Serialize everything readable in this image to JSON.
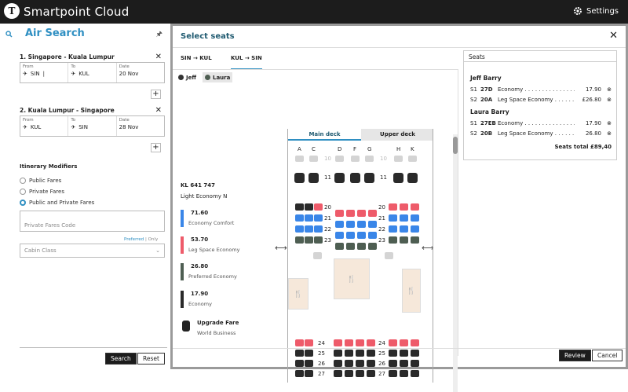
{
  "app": {
    "name": "Smartpoint Cloud",
    "settings": "Settings"
  },
  "left": {
    "title": "Air Search",
    "segments": [
      {
        "title": "1. Singapore - Kuala Lumpur",
        "from_label": "From",
        "from": "SIN",
        "to_label": "To",
        "to": "KUL",
        "date_label": "Date",
        "date": "20 Nov"
      },
      {
        "title": "2. Kuala Lumpur - Singapore",
        "from_label": "From",
        "from": "KUL",
        "to_label": "To",
        "to": "SIN",
        "date_label": "Date",
        "date": "28 Nov"
      }
    ],
    "modifiers_title": "Itinerary Modifiers",
    "fares": [
      "Public Fares",
      "Private Fares",
      "Public and Private Fares"
    ],
    "private_code_placeholder": "Private Fares Code",
    "preferred": "Preferred",
    "only": "Only",
    "pipe": "|",
    "cabin_class": "Cabin Class",
    "search": "Search",
    "reset": "Reset"
  },
  "modal": {
    "title": "Select seats",
    "direction_tabs": [
      "SIN → KUL",
      "KUL → SIN"
    ],
    "passenger_tabs": [
      "Jeff",
      "Laura"
    ],
    "flight": "KL 641   747",
    "cabin": "Light Economy   N",
    "deck_tabs": [
      "Main deck",
      "Upper deck"
    ],
    "columns": [
      "A",
      "C",
      "D",
      "F",
      "G",
      "H",
      "K"
    ],
    "rows_upper": [
      "11"
    ],
    "rows_mid": [
      "20",
      "21",
      "22",
      "23"
    ],
    "rows_low": [
      "24",
      "25",
      "26",
      "27"
    ],
    "row_muted": "10",
    "legend": [
      {
        "price": "71.60",
        "name": "Economy Comfort",
        "color": "#3a86e8"
      },
      {
        "price": "53.70",
        "name": "Leg Space Economy",
        "color": "#ee5b6a"
      },
      {
        "price": "26.80",
        "name": "Preferred Economy",
        "color": "#4e5e52"
      },
      {
        "price": "17.90",
        "name": "Economy",
        "color": "#2a2a2a"
      },
      {
        "price": "Upgrade Fare",
        "name": "World Business",
        "color": "#2a2a2a"
      }
    ],
    "seats_header": "Seats",
    "passengers": [
      {
        "name": "Jeff Barry",
        "seats": [
          {
            "seg": "S1",
            "seat": "27D",
            "cabin": "Economy",
            "dots": " . . . . . . . . . . . . . . . . . . . . . . ",
            "price": "17.90"
          },
          {
            "seg": "S2",
            "seat": "20A",
            "cabin": "Leg Space Economy",
            "dots": " . . . . . . . . . . . . ",
            "price": "£26.80"
          }
        ]
      },
      {
        "name": "Laura Barry",
        "seats": [
          {
            "seg": "S1",
            "seat": "27EB",
            "cabin": "Economy",
            "dots": " . . . . . . . . . . . . . . . . . . . . . . ",
            "price": "17.90"
          },
          {
            "seg": "S2",
            "seat": "20B",
            "cabin": "Leg Space Economy",
            "dots": " . . . . . . . . . . . . . ",
            "price": "26.80"
          }
        ]
      }
    ],
    "total": "Seats total £89,40",
    "review": "Review",
    "cancel": "Cancel"
  }
}
